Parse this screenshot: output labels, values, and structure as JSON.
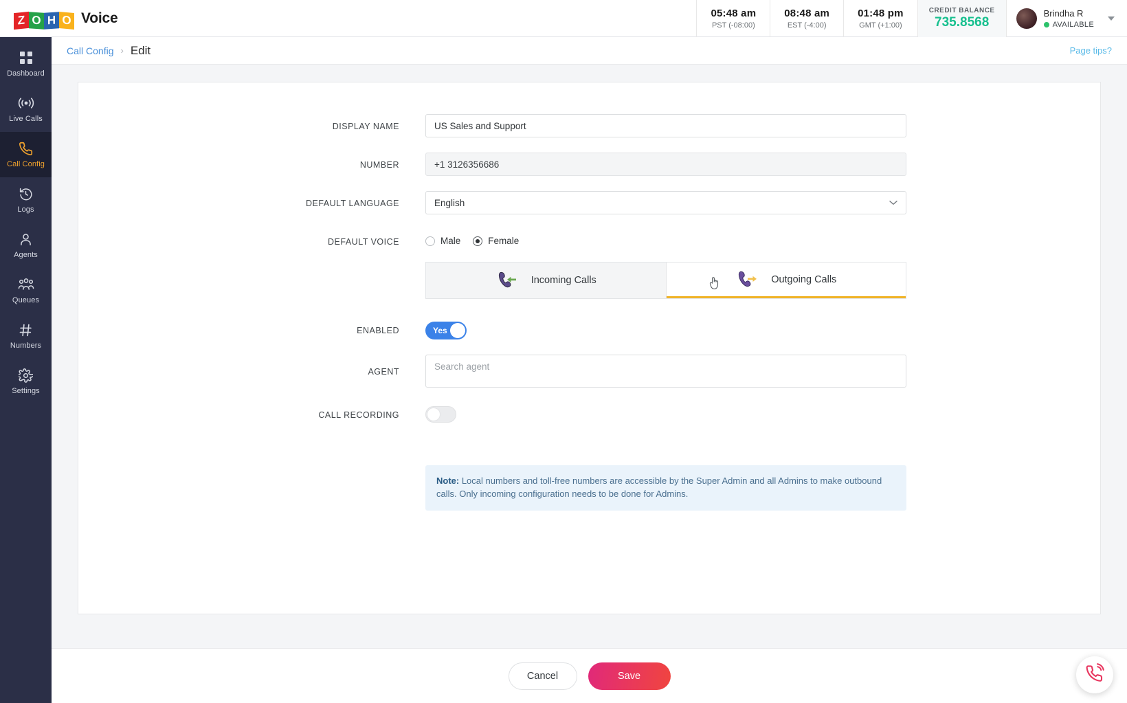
{
  "header": {
    "brand": {
      "logo_letters": [
        "Z",
        "O",
        "H",
        "O"
      ],
      "product": "Voice"
    },
    "clocks": [
      {
        "time": "05:48 am",
        "zone": "PST (-08:00)"
      },
      {
        "time": "08:48 am",
        "zone": "EST (-4:00)"
      },
      {
        "time": "01:48 pm",
        "zone": "GMT (+1:00)"
      }
    ],
    "credit": {
      "label": "CREDIT BALANCE",
      "value": "735.8568",
      "color": "#18c08f"
    },
    "user": {
      "name": "Brindha R",
      "status": "AVAILABLE",
      "status_color": "#2dc26b"
    }
  },
  "sidebar": {
    "items": [
      {
        "label": "Dashboard",
        "icon": "grid-icon",
        "active": false
      },
      {
        "label": "Live Calls",
        "icon": "broadcast-icon",
        "active": false
      },
      {
        "label": "Call Config",
        "icon": "phone-icon",
        "active": true
      },
      {
        "label": "Logs",
        "icon": "history-icon",
        "active": false
      },
      {
        "label": "Agents",
        "icon": "user-icon",
        "active": false
      },
      {
        "label": "Queues",
        "icon": "group-icon",
        "active": false
      },
      {
        "label": "Numbers",
        "icon": "hash-icon",
        "active": false
      },
      {
        "label": "Settings",
        "icon": "gear-icon",
        "active": false
      }
    ],
    "active_color": "#f0a22e"
  },
  "subheader": {
    "breadcrumb_parent": "Call Config",
    "breadcrumb_separator": "›",
    "breadcrumb_current": "Edit",
    "page_tips": "Page tips?"
  },
  "form": {
    "display_name": {
      "label": "DISPLAY NAME",
      "value": "US Sales and Support"
    },
    "number": {
      "label": "NUMBER",
      "value": "+1 3126356686"
    },
    "default_language": {
      "label": "DEFAULT LANGUAGE",
      "value": "English",
      "chevron": "⌄"
    },
    "default_voice": {
      "label": "DEFAULT VOICE",
      "options": [
        {
          "label": "Male",
          "selected": false
        },
        {
          "label": "Female",
          "selected": true
        }
      ]
    },
    "tabs": [
      {
        "label": "Incoming Calls",
        "icon": "incoming-call-icon",
        "active": false,
        "arrow_color": "#6aa84f"
      },
      {
        "label": "Outgoing Calls",
        "icon": "outgoing-call-icon",
        "active": true,
        "arrow_color": "#f2c14e"
      }
    ],
    "enabled": {
      "label": "ENABLED",
      "value": "Yes",
      "on": true
    },
    "agent": {
      "label": "AGENT",
      "placeholder": "Search agent",
      "value": ""
    },
    "call_recording": {
      "label": "CALL RECORDING",
      "on": false
    },
    "note": {
      "prefix": "Note:",
      "text": " Local numbers and toll-free numbers are accessible by the Super Admin and all Admins to make outbound calls. Only incoming configuration needs to be done for Admins."
    }
  },
  "footer": {
    "cancel_label": "Cancel",
    "save_label": "Save",
    "fab_icon": "call-widget-icon"
  }
}
